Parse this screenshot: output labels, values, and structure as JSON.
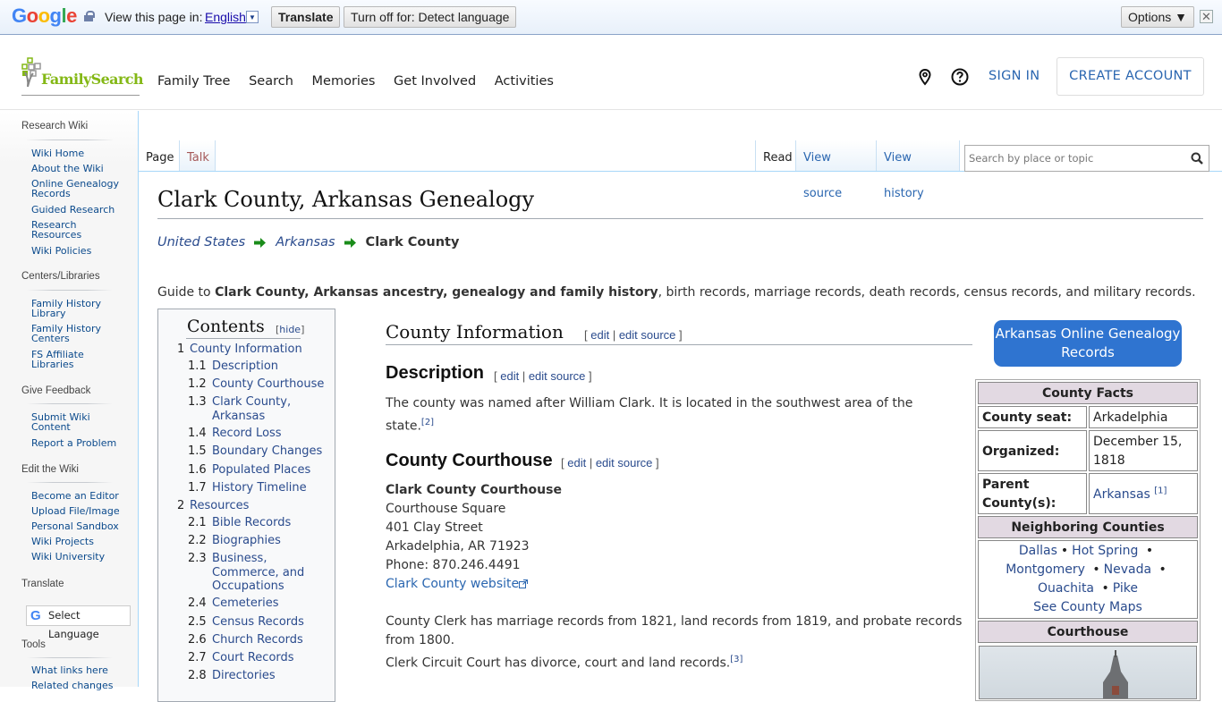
{
  "translate_bar": {
    "logo": [
      "G",
      "o",
      "o",
      "g",
      "l",
      "e"
    ],
    "view_in_label": "View this page in:",
    "language": "English",
    "translate_button": "Translate",
    "turn_off_button": "Turn off for: Detect language",
    "options_button": "Options ▼",
    "close": "✕"
  },
  "header": {
    "logo_text": "FamilySearch",
    "nav": [
      "Family Tree",
      "Search",
      "Memories",
      "Get Involved",
      "Activities"
    ],
    "sign_in": "SIGN IN",
    "create_account": "CREATE ACCOUNT"
  },
  "sidebar": {
    "sections": [
      {
        "heading": "Research Wiki",
        "items": [
          "Wiki Home",
          "About the Wiki",
          "Online Genealogy Records",
          "Guided Research",
          "Research Resources",
          "Wiki Policies"
        ]
      },
      {
        "heading": "Centers/Libraries",
        "items": [
          "Family History Library",
          "Family History Centers",
          "FS Affiliate Libraries"
        ]
      },
      {
        "heading": "Give Feedback",
        "items": [
          "Submit Wiki Content",
          "Report a Problem"
        ]
      },
      {
        "heading": "Edit the Wiki",
        "items": [
          "Become an Editor",
          "Upload File/Image",
          "Personal Sandbox",
          "Wiki Projects",
          "Wiki University"
        ]
      },
      {
        "heading": "Translate",
        "select_language": "Select Language"
      },
      {
        "heading": "Tools",
        "items": [
          "What links here",
          "Related changes"
        ]
      }
    ]
  },
  "tabs": {
    "page": "Page",
    "talk": "Talk",
    "read": "Read",
    "view_source": "View source",
    "view_history": "View history",
    "search_placeholder": "Search by place or topic"
  },
  "page": {
    "title": "Clark County, Arkansas Genealogy",
    "breadcrumb": [
      "United States",
      "Arkansas",
      "Clark County"
    ],
    "intro_prefix": "Guide to ",
    "intro_bold": "Clark County, Arkansas ancestry, genealogy and family history",
    "intro_suffix": ", birth records, marriage records, death records, census records, and military records."
  },
  "toc": {
    "title": "Contents",
    "hide": "hide",
    "items": [
      {
        "num": "1",
        "text": "County Information"
      },
      {
        "num": "1.1",
        "text": "Description"
      },
      {
        "num": "1.2",
        "text": "County Courthouse"
      },
      {
        "num": "1.3",
        "text": "Clark County, Arkansas"
      },
      {
        "num": "1.4",
        "text": "Record Loss"
      },
      {
        "num": "1.5",
        "text": "Boundary Changes"
      },
      {
        "num": "1.6",
        "text": "Populated Places"
      },
      {
        "num": "1.7",
        "text": "History Timeline"
      },
      {
        "num": "2",
        "text": "Resources"
      },
      {
        "num": "2.1",
        "text": "Bible Records"
      },
      {
        "num": "2.2",
        "text": "Biographies"
      },
      {
        "num": "2.3",
        "text": "Business, Commerce, and Occupations"
      },
      {
        "num": "2.4",
        "text": "Cemeteries"
      },
      {
        "num": "2.5",
        "text": "Census Records"
      },
      {
        "num": "2.6",
        "text": "Church Records"
      },
      {
        "num": "2.7",
        "text": "Court Records"
      },
      {
        "num": "2.8",
        "text": "Directories"
      }
    ]
  },
  "content": {
    "edit": "edit",
    "edit_source": "edit source",
    "county_information_heading": "County Information",
    "description_heading": "Description",
    "description_text": "The county was named after William Clark. It is located in the southwest area of the state.",
    "description_ref": "[2]",
    "courthouse_heading": "County Courthouse",
    "courthouse_name": "Clark County Courthouse",
    "address_lines": [
      "Courthouse Square",
      "401 Clay Street",
      "Arkadelphia, AR 71923",
      "Phone: 870.246.4491"
    ],
    "website_link": "Clark County website",
    "clerk_text_1": "County Clerk has marriage records from 1821, land records from 1819, and probate records from 1800.",
    "clerk_text_2": "Clerk Circuit Court has divorce, court and land records.",
    "clerk_ref": "[3]"
  },
  "infobox": {
    "online_records_button": "Arkansas Online Genealogy Records",
    "facts_heading": "County Facts",
    "county_seat_label": "County seat:",
    "county_seat_value": "Arkadelphia",
    "organized_label": "Organized:",
    "organized_value": "December 15, 1818",
    "parent_label": "Parent County(s):",
    "parent_value": "Arkansas",
    "parent_ref": "[1]",
    "neighboring_heading": "Neighboring Counties",
    "neighbors": [
      "Dallas",
      "Hot Spring",
      "Montgomery",
      "Nevada",
      "Ouachita",
      "Pike"
    ],
    "see_maps": "See County Maps",
    "courthouse_heading": "Courthouse"
  },
  "colors": {
    "link": "#2a4b8d",
    "fs_green": "#84b816",
    "button_blue": "#2f74d0",
    "infobox_header": "#e2d9e2"
  }
}
